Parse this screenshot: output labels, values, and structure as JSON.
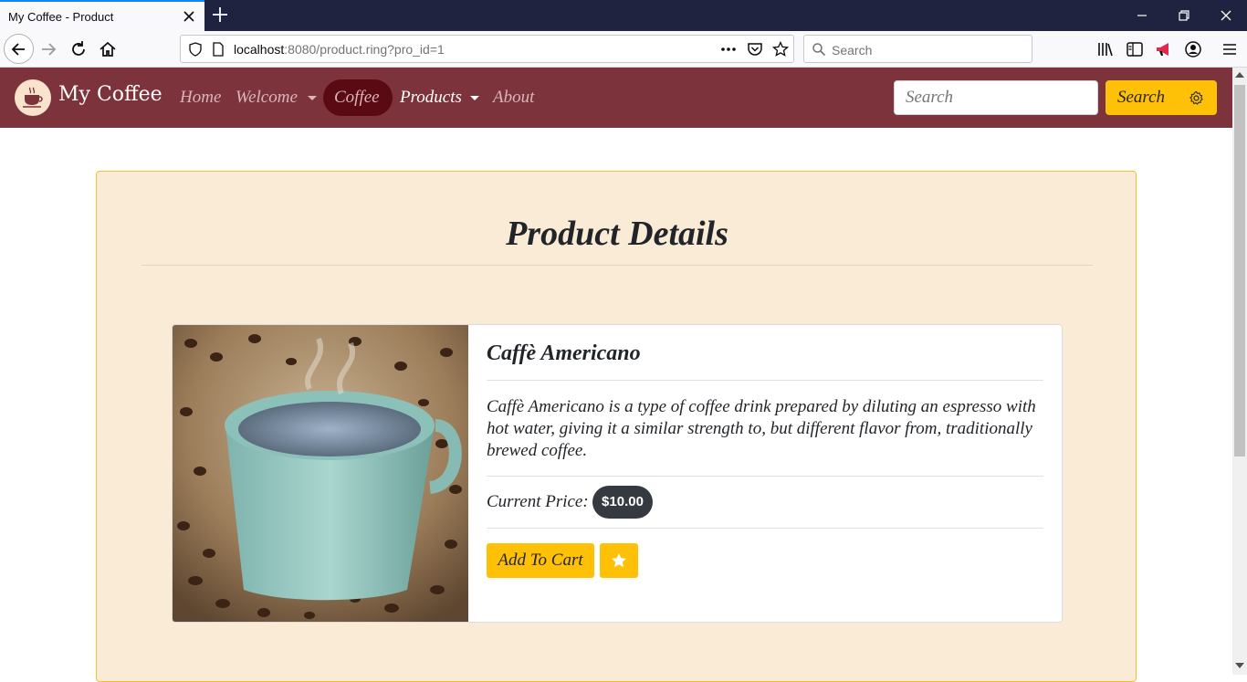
{
  "browser": {
    "tab_title": "My Coffee - Product",
    "url_host": "localhost",
    "url_rest": ":8080/product.ring?pro_id=1",
    "search_placeholder": "Search"
  },
  "site": {
    "brand": "My Coffee",
    "nav": {
      "home": "Home",
      "welcome": "Welcome",
      "coffee": "Coffee",
      "products": "Products",
      "about": "About"
    },
    "search_placeholder": "Search",
    "search_button": "Search"
  },
  "page": {
    "title": "Product Details"
  },
  "product": {
    "name": "Caffè Americano",
    "description": "Caffè Americano is a type of coffee drink prepared by diluting an espresso with hot water, giving it a similar strength to, but different flavor from, traditionally brewed coffee.",
    "price_label": "Current Price:",
    "price": "$10.00",
    "add_to_cart": "Add To Cart",
    "favorite_icon": "star-icon"
  },
  "colors": {
    "navbar": "#7d333b",
    "accent": "#ffc107",
    "panel": "#faebd7",
    "active_pill": "#5a0a12"
  }
}
